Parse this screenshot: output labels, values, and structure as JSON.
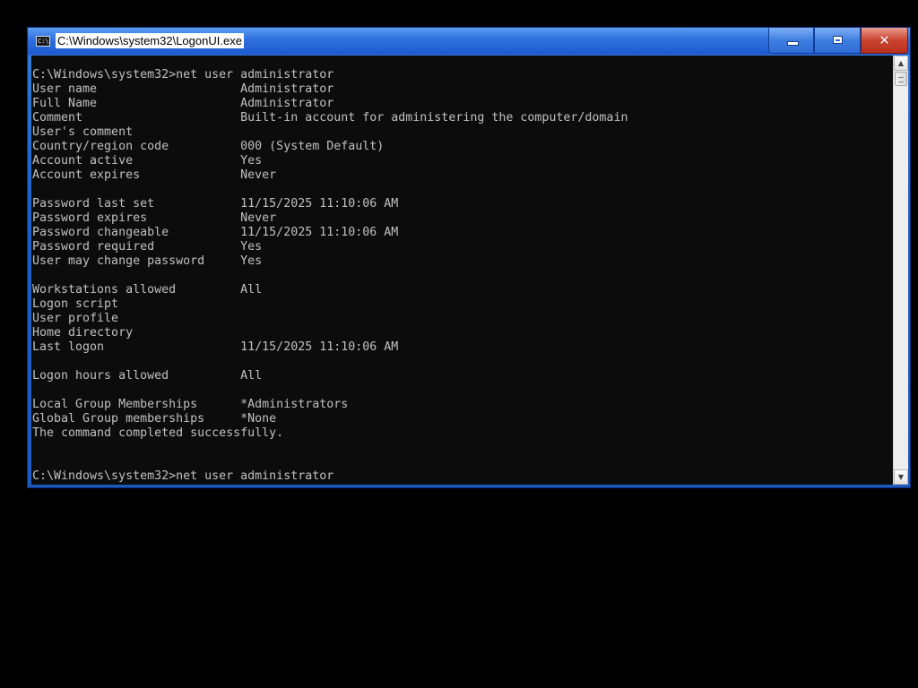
{
  "window": {
    "title": "C:\\Windows\\system32\\LogonUI.exe",
    "icon": "cmd-icon",
    "icon_text": "C:\\",
    "controls": {
      "minimize_icon": "minimize-icon",
      "maximize_icon": "maximize-icon",
      "close_glyph": "✕"
    }
  },
  "console": {
    "lines": [
      "C:\\Windows\\system32>net user administrator",
      "User name                    Administrator",
      "Full Name                    Administrator",
      "Comment                      Built-in account for administering the computer/domain",
      "User's comment",
      "Country/region code          000 (System Default)",
      "Account active               Yes",
      "Account expires              Never",
      "",
      "Password last set            11/15/2025 11:10:06 AM",
      "Password expires             Never",
      "Password changeable          11/15/2025 11:10:06 AM",
      "Password required            Yes",
      "User may change password     Yes",
      "",
      "Workstations allowed         All",
      "Logon script",
      "User profile",
      "Home directory",
      "Last logon                   11/15/2025 11:10:06 AM",
      "",
      "Logon hours allowed          All",
      "",
      "Local Group Memberships      *Administrators",
      "Global Group memberships     *None",
      "The command completed successfully.",
      "",
      "",
      "C:\\Windows\\system32>net user administrator"
    ]
  },
  "scrollbar": {
    "up_arrow": "▲",
    "down_arrow": "▼"
  },
  "colors": {
    "console_bg": "#0c0c0c",
    "console_fg": "#c0c0c0",
    "titlebar": "#2d6fdc",
    "close_button": "#c9442f"
  }
}
